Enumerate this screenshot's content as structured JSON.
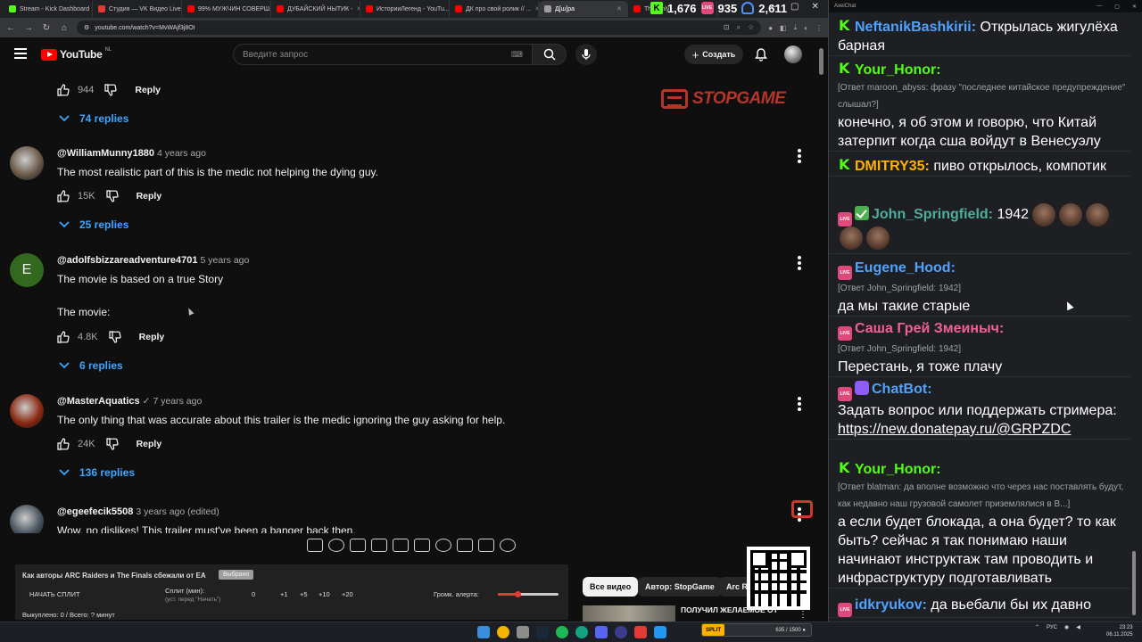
{
  "browser": {
    "tabs": [
      {
        "label": "Stream - Kick Dashboard",
        "color": "#53fc18"
      },
      {
        "label": "Студия — VK Видео Live",
        "color": "#e53935"
      },
      {
        "label": "99% МУЖЧИН СОВЕРШ...",
        "color": "#ff0000"
      },
      {
        "label": "ДУБАЙСКИЙ НЫТИК -",
        "color": "#ff0000"
      },
      {
        "label": "ИсторииЛегенд - YouTu...",
        "color": "#ff0000"
      },
      {
        "label": "ДК про свой ролик // ...",
        "color": "#ff0000"
      },
      {
        "label": "Д[ш]ра",
        "color": "#9e9e9e"
      },
      {
        "label": "The Only",
        "color": "#ff0000"
      }
    ],
    "url": "youtube.com/watch?v=MvWAjf3j8OI"
  },
  "stream_stats": {
    "kick_viewers": "1,676",
    "vk_viewers": "935",
    "total_viewers": "2,611"
  },
  "youtube": {
    "logo_text": "YouTube",
    "region": "NL",
    "search_placeholder": "Введите запрос",
    "create_label": "Создать"
  },
  "watermark": {
    "text": "STOPGAME"
  },
  "comments": {
    "top_actions": {
      "likes": "944",
      "reply_label": "Reply",
      "replies_label": "74 replies"
    },
    "items": [
      {
        "author": "@WilliamMunny1880",
        "time": "4 years ago",
        "text": "The most realistic part of this is the medic not helping the dying guy.",
        "likes": "15K",
        "reply_label": "Reply",
        "replies_label": "25 replies",
        "avatar_color": "#6b5a4a"
      },
      {
        "author": "@adolfsbizzareadventure4701",
        "time": "5 years ago",
        "text": "The movie is based on a true Story",
        "text2": "The movie:",
        "likes": "4.8K",
        "reply_label": "Reply",
        "replies_label": "6 replies",
        "avatar_letter": "E",
        "avatar_color": "#33691e"
      },
      {
        "author": "@MasterAquatics",
        "verified": "✓",
        "time": "7 years ago",
        "text": "The only thing that was accurate about this trailer is the medic ignoring the guy asking for help.",
        "likes": "24K",
        "reply_label": "Reply",
        "replies_label": "136 replies",
        "avatar_color": "#8b2a12"
      },
      {
        "author": "@egeefecik5508",
        "time": "3 years ago (edited)",
        "text": "Wow, no dislikes! This trailer must've been a banger back then.",
        "avatar_color": "#4a5560"
      }
    ]
  },
  "overlay_panel": {
    "title": "Как авторы ARC Raiders и The Finals сбежали от EA",
    "tag": "Выбрано",
    "start_label": "НАЧАТЬ СПЛИТ",
    "split_label": "Сплит (мин):",
    "split_sub": "(уст. перед \"Начать\")",
    "split_value": "0",
    "increments": [
      "+1",
      "+5",
      "+10",
      "+20"
    ],
    "alert_label": "Громк. алерта:",
    "alert_level": 0.33,
    "stats": "Выкуплено: 0 / Всего: ? минут"
  },
  "chips": {
    "all": "Все видео",
    "author": "Автор: StopGame",
    "arc": "Arc Ra"
  },
  "recommendation": {
    "title": "ПОЛУЧИЛ ЖЕЛАЕМОЕ ОТ"
  },
  "chat": {
    "window_title": "AxelChat",
    "messages": [
      {
        "badges": [
          "kick"
        ],
        "name": "NeftanikBashkirii",
        "name_color": "#4fa3ff",
        "text": "Открылась жигулёха барная"
      },
      {
        "badges": [
          "kick"
        ],
        "name": "Your_Honor",
        "name_color": "#53fc18",
        "reply_to": "[Ответ maroon_abyss: фразу \"последнее китайское предупреждение\" слышал?]",
        "text": "конечно, я об этом и говорю, что Китай затерпит когда сша войдут в Венесуэлу"
      },
      {
        "badges": [
          "kick"
        ],
        "name": "DMITRY35",
        "name_color": "#ffb300",
        "text": "пиво открылось, компотик"
      },
      {
        "badges": [
          "live",
          "check"
        ],
        "name": "John_Springfield",
        "name_color": "#4caf9c",
        "text": "1942"
      },
      {
        "badges": [
          "live"
        ],
        "name": "Eugene_Hood",
        "name_color": "#4fa3ff",
        "reply_to": "[Ответ John_Springfield: 1942]",
        "text": "да мы такие старые"
      },
      {
        "badges": [
          "live"
        ],
        "name": "Саша Грей Змеиныч",
        "name_color": "#f06292",
        "reply_to": "[Ответ John_Springfield: 1942]",
        "text": "Перестань, я тоже плачу"
      },
      {
        "badges": [
          "live",
          "bot"
        ],
        "name": "ChatBot",
        "name_color": "#4fa3ff",
        "text": "Задать вопрос или поддержать стримера:",
        "link": "https://new.donatepay.ru/@GRPZDC"
      },
      {
        "badges": [
          "kick"
        ],
        "name": "Your_Honor",
        "name_color": "#53fc18",
        "reply_to": "[Ответ blatman: да вполне возможно что через нас поставлять будут, как недавно наш грузовой самолет приземлялися в В...]",
        "text": "а если будет блокада, а она будет? то как быть? сейчас я так понимаю наши начинают инструктаж там проводить и инфраструктуру подготавливать"
      },
      {
        "badges": [
          "live"
        ],
        "name": "idkryukov",
        "name_color": "#4fa3ff",
        "text": "да вьебали бы их давно"
      }
    ]
  },
  "taskbar": {
    "kick_widget_label": "SPLIT",
    "kick_widget_value": "635 / 1500 ●",
    "lang": "РУС",
    "time": "23:23",
    "date": "06.11.2025"
  }
}
